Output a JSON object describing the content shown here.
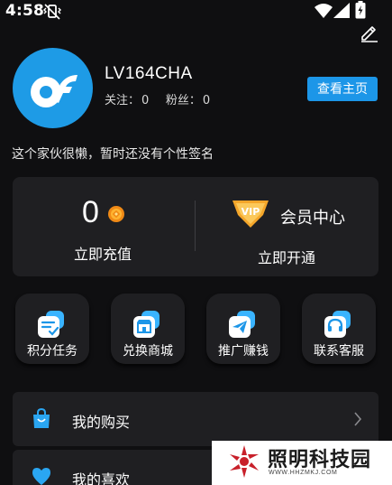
{
  "status_bar": {
    "time": "4:58"
  },
  "profile": {
    "username": "LV164CHA",
    "follow_label": "关注：",
    "follow_count": "0",
    "fans_label": "粉丝：",
    "fans_count": "0",
    "homepage_button": "查看主页",
    "signature": "这个家伙很懒，暂时还没有个性签名"
  },
  "wallet": {
    "balance": "0",
    "recharge_label": "立即充值",
    "member_title": "会员中心",
    "open_label": "立即开通",
    "vip_badge": "VIP"
  },
  "shortcuts": [
    {
      "label": "积分任务",
      "icon": "tasks-icon"
    },
    {
      "label": "兑换商城",
      "icon": "shop-icon"
    },
    {
      "label": "推广赚钱",
      "icon": "paper-plane-icon"
    },
    {
      "label": "联系客服",
      "icon": "headset-icon"
    }
  ],
  "menu": [
    {
      "label": "我的购买",
      "icon": "shopping-bag-icon"
    },
    {
      "label": "我的喜欢",
      "icon": "heart-icon"
    }
  ],
  "watermark": {
    "title": "照明科技园",
    "url": "WWW.HHZMKJ.COM"
  },
  "colors": {
    "accent": "#1c96e8",
    "background": "#0f0f11",
    "card": "#1f1f22",
    "coin": "#f08a16"
  }
}
